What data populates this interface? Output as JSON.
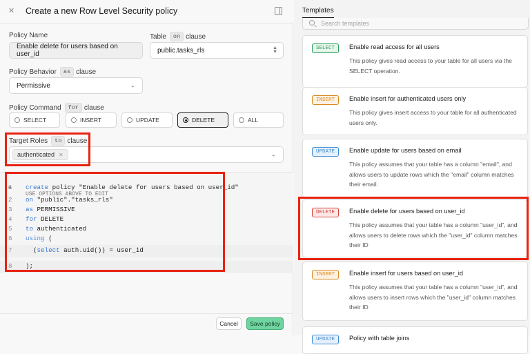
{
  "header": {
    "title": "Create a new Row Level Security policy"
  },
  "form": {
    "policy_name": {
      "label": "Policy Name",
      "value": "Enable delete for users based on user_id"
    },
    "table": {
      "label": "Table",
      "badge": "on",
      "clause": "clause",
      "value": "public.tasks_rls"
    },
    "behavior": {
      "label": "Policy Behavior",
      "badge": "as",
      "clause": "clause",
      "value": "Permissive"
    },
    "command": {
      "label": "Policy Command",
      "badge": "for",
      "clause": "clause",
      "options": [
        "SELECT",
        "INSERT",
        "UPDATE",
        "DELETE",
        "ALL"
      ],
      "selected": "DELETE"
    },
    "roles": {
      "label": "Target Roles",
      "badge": "to",
      "clause": "clause",
      "chip": "authenticated"
    }
  },
  "editor": {
    "hint": "USE OPTIONS ABOVE TO EDIT",
    "lines": [
      {
        "num": "1",
        "parts": [
          [
            "kw",
            "create"
          ],
          [
            "plain",
            " policy "
          ],
          [
            "str",
            "\"Enable delete for users based on user_id\""
          ]
        ]
      },
      {
        "num": "2",
        "parts": [
          [
            "kw",
            "on"
          ],
          [
            "plain",
            " "
          ],
          [
            "str",
            "\"public\".\"tasks_rls\""
          ]
        ]
      },
      {
        "num": "3",
        "parts": [
          [
            "kw",
            "as"
          ],
          [
            "plain",
            " PERMISSIVE"
          ]
        ]
      },
      {
        "num": "4",
        "parts": [
          [
            "kw",
            "for"
          ],
          [
            "plain",
            " DELETE"
          ]
        ]
      },
      {
        "num": "5",
        "parts": [
          [
            "kw",
            "to"
          ],
          [
            "plain",
            " authenticated"
          ]
        ]
      },
      {
        "num": "6",
        "parts": [
          [
            "lightkw",
            "using"
          ],
          [
            "plain",
            " ("
          ]
        ]
      },
      {
        "num": "7",
        "parts": [
          [
            "plain",
            "  ("
          ],
          [
            "kw",
            "select"
          ],
          [
            "plain",
            " auth.uid()) = user_id"
          ]
        ]
      },
      {
        "num": "8",
        "parts": [
          [
            "plain",
            "); "
          ]
        ]
      }
    ]
  },
  "footer": {
    "cancel": "Cancel",
    "save": "Save policy"
  },
  "templates": {
    "tab": "Templates",
    "search_placeholder": "Search templates",
    "cards": [
      {
        "tag": "SELECT",
        "title": "Enable read access for all users",
        "desc": "This policy gives read access to your table for all users via the SELECT operation."
      },
      {
        "tag": "INSERT",
        "title": "Enable insert for authenticated users only",
        "desc": "This policy gives insert access to your table for all authenticated users only."
      },
      {
        "tag": "UPDATE",
        "title": "Enable update for users based on email",
        "desc": "This policy assumes that your table has a column \"email\", and allows users to update rows which the \"email\" column matches their email."
      },
      {
        "tag": "DELETE",
        "title": "Enable delete for users based on user_id",
        "desc": "This policy assumes that your table has a column \"user_id\", and allows users to delete rows which the \"user_id\" column matches their ID"
      },
      {
        "tag": "INSERT",
        "title": "Enable insert for users based on user_id",
        "desc": "This policy assumes that your table has a column \"user_id\", and allows users to insert rows which the \"user_id\" column matches their ID"
      },
      {
        "tag": "UPDATE",
        "title": "Policy with table joins",
        "desc": ""
      }
    ]
  },
  "colors": {
    "highlight": "#e8220f",
    "save_green": "#6fd4a0",
    "select_tag": "#2e9e5b",
    "insert_tag": "#d98a1f",
    "update_tag": "#3d8bd4",
    "delete_tag": "#d6423a"
  }
}
